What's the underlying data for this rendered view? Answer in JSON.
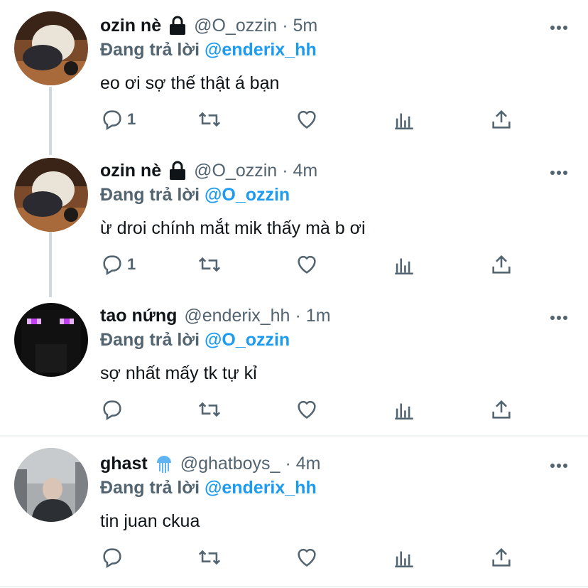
{
  "tweets": [
    {
      "name": "ozin nè",
      "handle": "@O_ozzin",
      "separator": "·",
      "time": "5m",
      "reply_label": "Đang trả lời",
      "reply_to": "@enderix_hh",
      "text": "eo ơi sợ thế thật á bạn",
      "reply_count": "1",
      "badge": "lock-icon",
      "avatar": "blonde-person-at-table"
    },
    {
      "name": "ozin nè",
      "handle": "@O_ozzin",
      "separator": "·",
      "time": "4m",
      "reply_label": "Đang trả lời",
      "reply_to": "@O_ozzin",
      "text": "ừ droi chính mắt mik thấy mà b ơi",
      "reply_count": "1",
      "badge": "lock-icon",
      "avatar": "blonde-person-at-table"
    },
    {
      "name": "tao nứng",
      "handle": "@enderix_hh",
      "separator": "·",
      "time": "1m",
      "reply_label": "Đang trả lời",
      "reply_to": "@O_ozzin",
      "text": "sợ nhất mấy tk tự kỉ",
      "reply_count": "",
      "badge": "",
      "avatar": "enderman"
    },
    {
      "name": "ghast",
      "handle": "@ghatboys_",
      "separator": "·",
      "time": "4m",
      "reply_label": "Đang trả lời",
      "reply_to": "@enderix_hh",
      "text": "tin juan ckua",
      "reply_count": "",
      "badge": "jellyfish-emoji",
      "avatar": "person-in-snow"
    }
  ],
  "colors": {
    "accent": "#1d9bf0",
    "secondary_text": "#536471",
    "thread_line": "#cfd9de",
    "divider": "#eff3f4"
  }
}
